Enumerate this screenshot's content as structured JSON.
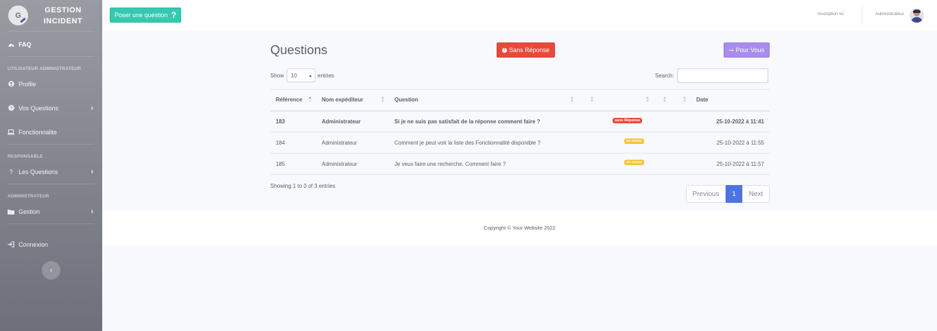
{
  "sidebar": {
    "brand_line1": "GESTION",
    "brand_line2": "INCIDENT",
    "logo_letter": "G",
    "items": {
      "faq": "FAQ",
      "profile": "Profile",
      "vos_questions": "Vos Questions",
      "fonctionnalite": "Fonctionnalite",
      "les_questions": "Les Questions",
      "gestion": "Gestion",
      "connexion": "Connexion"
    },
    "headings": {
      "util_admin": "UTILISATEUR ADMINISTRATEUR",
      "responsable": "RESPONSABLE",
      "administrateur": "ADMINISTRATEUR"
    }
  },
  "topbar": {
    "ask_button": "Poser une question",
    "ask_icon": "?",
    "inscription": "Inscription Ici",
    "user_name": "Administrateur"
  },
  "main": {
    "title": "Questions",
    "btn_sans_reponse": "Sans Réponse",
    "btn_pour_vous": "Pour Vous",
    "show_label": "Show",
    "show_value": "10",
    "entries_label": "entries",
    "search_label": "Search:",
    "table": {
      "headers": [
        "Référence",
        "Nom expéditeur",
        "Question",
        "",
        "",
        "",
        "",
        "Date"
      ],
      "rows": [
        {
          "ref": "183",
          "sender": "Administrateur",
          "question": "Si je ne suis pas satisfait de la réponse comment faire ?",
          "status": "sans Réponse",
          "date": "25-10-2022 à 11:41"
        },
        {
          "ref": "184",
          "sender": "Administrateur",
          "question": "Comment je peut voir la liste des Fonctionnalité disponible ?",
          "status": "en cours",
          "date": "25-10-2022 à 11:55"
        },
        {
          "ref": "185",
          "sender": "Administrateur",
          "question": "Je veux faire une recherche, Comment faire ?",
          "status": "en cours",
          "date": "25-10-2022 à 11:57"
        }
      ]
    },
    "showing": "Showing 1 to 3 of 3 entries",
    "pager": {
      "prev": "Previous",
      "page": "1",
      "next": "Next"
    }
  },
  "footer": {
    "copyright": "Copyright © Your Website 2022"
  },
  "colors": {
    "accent": "#4e73df",
    "danger": "#e74a3b",
    "warning": "#f6c23e",
    "teal": "#36c9b0",
    "purple": "#a98ceb"
  }
}
